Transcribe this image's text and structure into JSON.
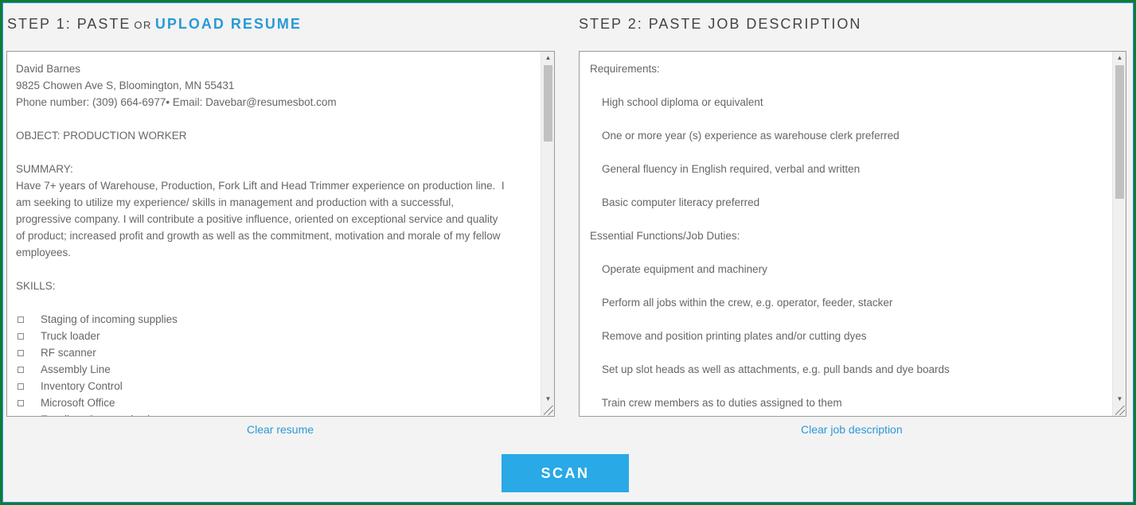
{
  "step1": {
    "title_prefix": "STEP 1: PASTE",
    "title_or": "OR",
    "upload_label": "UPLOAD RESUME"
  },
  "step2": {
    "title": "STEP 2: PASTE JOB DESCRIPTION"
  },
  "resume": {
    "lines": [
      "David Barnes",
      "9825 Chowen Ave S, Bloomington, MN 55431",
      "Phone number: (309) 664-6977• Email: Davebar@resumesbot.com",
      "",
      "OBJECT: PRODUCTION WORKER",
      "",
      "SUMMARY:",
      "Have 7+ years of Warehouse, Production, Fork Lift and Head Trimmer experience on production line.  I",
      "am seeking to utilize my experience/ skills in management and production with a successful,",
      "progressive company. I will contribute a positive influence, oriented on exceptional service and quality",
      "of product; increased profit and growth as well as the commitment, motivation and morale of my fellow",
      "employees.",
      "",
      "SKILLS:",
      ""
    ],
    "skills": [
      "Staging of incoming supplies",
      "Truck loader",
      "RF scanner",
      "Assembly Line",
      "Inventory Control",
      "Microsoft Office",
      "Excellent Communicati..."
    ],
    "clear_label": "Clear resume"
  },
  "job": {
    "lines": [
      "Requirements:",
      "",
      "    High school diploma or equivalent",
      "",
      "    One or more year (s) experience as warehouse clerk preferred",
      "",
      "    General fluency in English required, verbal and written",
      "",
      "    Basic computer literacy preferred",
      "",
      "Essential Functions/Job Duties:",
      "",
      "    Operate equipment and machinery",
      "",
      "    Perform all jobs within the crew, e.g. operator, feeder, stacker",
      "",
      "    Remove and position printing plates and/or cutting dyes",
      "",
      "    Set up slot heads as well as attachments, e.g. pull bands and dye boards",
      "",
      "    Train crew members as to duties assigned to them",
      ""
    ],
    "clear_label": "Clear job description"
  },
  "scan_label": "SCAN",
  "colors": {
    "accent": "#2a9ad6",
    "button": "#29a9e6",
    "frame": "#0f7a3a"
  },
  "icons": {
    "scroll_up": "arrow-up-icon",
    "scroll_down": "arrow-down-icon",
    "resize": "resize-grip-icon",
    "bullet": "checkbox-bullet-icon"
  }
}
